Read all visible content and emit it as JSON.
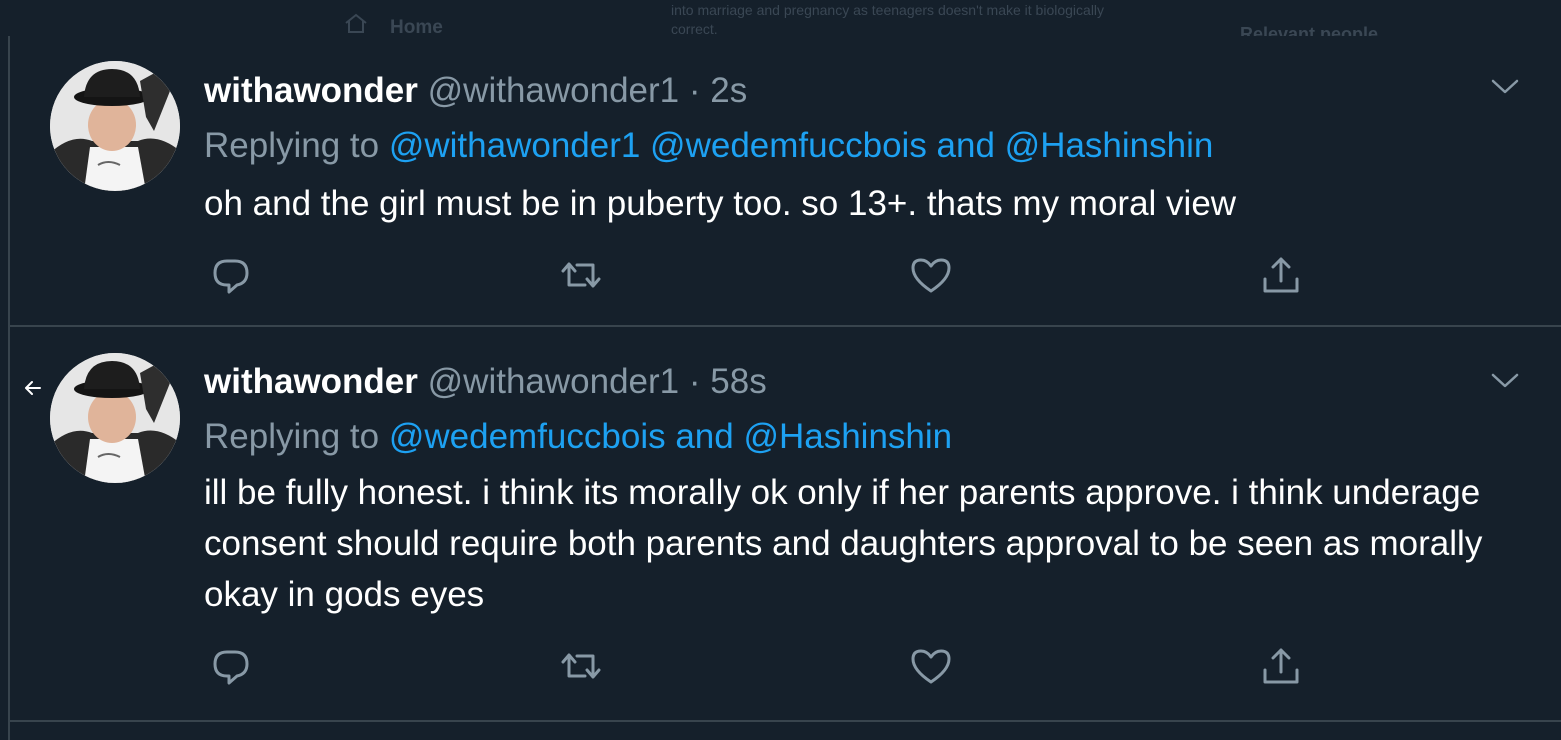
{
  "background": {
    "nav_label": "Home",
    "header_text": "into marriage and pregnancy as teenagers doesn't make it biologically correct.",
    "sidebar_heading": "Relevant people"
  },
  "colors": {
    "background": "#15202b",
    "border": "#38444d",
    "secondary_text": "#8899a6",
    "link": "#1da1f2",
    "primary_text": "#ffffff"
  },
  "icons": {
    "reply": "reply-icon",
    "retweet": "retweet-icon",
    "like": "like-icon",
    "share": "share-icon",
    "more": "chevron-down-icon",
    "back": "back-arrow-icon",
    "home": "home-icon"
  },
  "tweets": [
    {
      "display_name": "withawonder",
      "handle": "@withawonder1",
      "separator": "·",
      "time": "2s",
      "replying_prefix": "Replying to",
      "mentions": "@withawonder1 @wedemfuccbois and @Hashinshin",
      "text": "oh and the girl must be in puberty too. so 13+. thats my moral view"
    },
    {
      "display_name": "withawonder",
      "handle": "@withawonder1",
      "separator": "·",
      "time": "58s",
      "replying_prefix": "Replying to",
      "mentions": "@wedemfuccbois and @Hashinshin",
      "text": "ill be fully honest. i think its morally ok only if her parents approve. i think underage consent should require both parents and daughters approval to be seen as morally okay in gods eyes"
    }
  ]
}
